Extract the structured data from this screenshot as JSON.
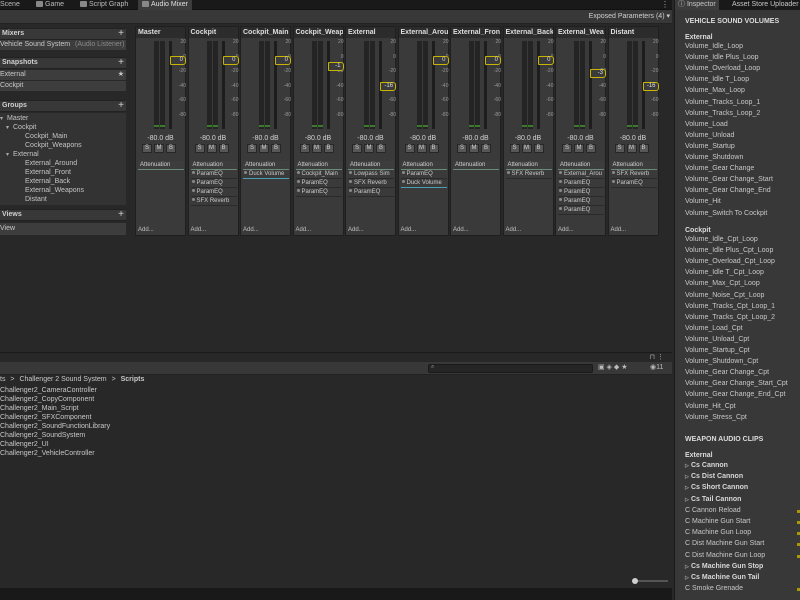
{
  "tabs": [
    {
      "label": "Scene",
      "icon": "scene-icon"
    },
    {
      "label": "Game",
      "icon": "game-icon"
    },
    {
      "label": "Script Graph",
      "icon": "graph-icon"
    },
    {
      "label": "Audio Mixer",
      "icon": "mixer-icon"
    }
  ],
  "toolbar": {
    "exposed_params": "Exposed Parameters (4)"
  },
  "mixers": {
    "title": "Mixers",
    "add": "+",
    "item": "Vehicle Sound System",
    "item_note": "(Audio Listener)"
  },
  "snapshots": {
    "title": "Snapshots",
    "add": "+",
    "items": [
      "External",
      "Cockpit"
    ],
    "star": "★"
  },
  "groups": {
    "title": "Groups",
    "add": "+",
    "tree": [
      "Master",
      "Cockpit",
      "Cockpit_Main",
      "Cockpit_Weapons",
      "External",
      "External_Around",
      "External_Front",
      "External_Back",
      "External_Weapons",
      "Distant"
    ]
  },
  "views": {
    "title": "Views",
    "add": "+",
    "items": [
      "View"
    ]
  },
  "strips": [
    {
      "name": "Master",
      "db": "-80.0 dB",
      "knob": "0",
      "effects": []
    },
    {
      "name": "Cockpit",
      "db": "-80.0 dB",
      "knob": "0",
      "effects": [
        "ParamEQ",
        "ParamEQ",
        "ParamEQ",
        "SFX Reverb"
      ]
    },
    {
      "name": "Cockpit_Main",
      "db": "-80.0 dB",
      "knob": "0",
      "effects": [
        "Duck Volume"
      ]
    },
    {
      "name": "Cockpit_Weap",
      "db": "-80.0 dB",
      "knob": "-1",
      "effects": [
        "Cockpit_Main",
        "ParamEQ",
        "ParamEQ"
      ]
    },
    {
      "name": "External",
      "db": "-80.0 dB",
      "knob": "-16",
      "effects": [
        "Lowpass Sim",
        "SFX Reverb",
        "ParamEQ"
      ]
    },
    {
      "name": "External_Arou",
      "db": "-80.0 dB",
      "knob": "0",
      "effects": [
        "ParamEQ",
        "Duck Volume"
      ]
    },
    {
      "name": "External_Fron",
      "db": "-80.0 dB",
      "knob": "0",
      "effects": []
    },
    {
      "name": "External_Back",
      "db": "-80.0 dB",
      "knob": "0",
      "effects": [
        "SFX Reverb"
      ]
    },
    {
      "name": "External_Wea",
      "db": "-80.0 dB",
      "knob": "-3",
      "effects": [
        "External_Arou",
        "ParamEQ",
        "ParamEQ",
        "ParamEQ",
        "ParamEQ"
      ]
    },
    {
      "name": "Distant",
      "db": "-80.0 dB",
      "knob": "-16",
      "effects": [
        "SFX Reverb",
        "ParamEQ"
      ]
    }
  ],
  "strip_common": {
    "atten": "Attenuation",
    "add": "Add...",
    "s": "S",
    "m": "M",
    "b": "B",
    "scale": [
      "20",
      "0",
      "-20",
      "-40",
      "-60",
      "-80"
    ]
  },
  "project": {
    "breadcrumb": [
      "ts",
      "Challenger 2 Sound System",
      "Scripts"
    ],
    "sep": ">",
    "count": "11",
    "files": [
      "Challenger2_CameraController",
      "Challenger2_CopyComponent",
      "Challenger2_Main_Script",
      "Challenger2_SFXComponent",
      "Challenger2_SoundFunctionLibrary",
      "Challenger2_SoundSystem",
      "Challenger2_UI",
      "Challenger2_VehicleController"
    ]
  },
  "inspector": {
    "tabs": [
      "Inspector",
      "Asset Store Uploader"
    ],
    "section1": "VEHICLE SOUND VOLUMES",
    "ext_label": "External",
    "external": [
      "Volume_Idle_Loop",
      "Volume_Idle Plus_Loop",
      "Volume_Overload_Loop",
      "Volume_Idle T_Loop",
      "Volume_Max_Loop",
      "Volume_Tracks_Loop_1",
      "Volume_Tracks_Loop_2",
      "Volume_Load",
      "Volume_Unload",
      "Volume_Startup",
      "Volume_Shutdown",
      "Volume_Gear Change",
      "Volume_Gear Change_Start",
      "Volume_Gear Change_End",
      "Volume_Hit",
      "Volume_Switch To Cockpit"
    ],
    "cpt_label": "Cockpit",
    "cockpit": [
      "Volume_Idle_Cpt_Loop",
      "Volume_Idle Plus_Cpt_Loop",
      "Volume_Overload_Cpt_Loop",
      "Volume_Idle T_Cpt_Loop",
      "Volume_Max_Cpt_Loop",
      "Volume_Noise_Cpt_Loop",
      "Volume_Tracks_Cpt_Loop_1",
      "Volume_Tracks_Cpt_Loop_2",
      "Volume_Load_Cpt",
      "Volume_Unload_Cpt",
      "Volume_Startup_Cpt",
      "Volume_Shutdown_Cpt",
      "Volume_Gear Change_Cpt",
      "Volume_Gear Change_Start_Cpt",
      "Volume_Gear Change_End_Cpt",
      "Volume_Hit_Cpt",
      "Volume_Stress_Cpt"
    ],
    "section2": "WEAPON AUDIO CLIPS",
    "w_ext_label": "External",
    "weapons": [
      {
        "t": "Cs Cannon",
        "b": true
      },
      {
        "t": "Cs Dist Cannon",
        "b": true
      },
      {
        "t": "Cs Short Cannon",
        "b": true
      },
      {
        "t": "Cs Tail Cannon",
        "b": true
      },
      {
        "t": "C Cannon Reload",
        "b": false
      },
      {
        "t": "C Machine Gun Start",
        "b": false
      },
      {
        "t": "C Machine Gun Loop",
        "b": false
      },
      {
        "t": "C Dist Machine Gun Start",
        "b": false
      },
      {
        "t": "C Dist Machine Gun Loop",
        "b": false
      },
      {
        "t": "Cs Machine Gun Stop",
        "b": true
      },
      {
        "t": "Cs Machine Gun Tail",
        "b": true
      },
      {
        "t": "C Smoke Grenade",
        "b": false
      }
    ]
  }
}
